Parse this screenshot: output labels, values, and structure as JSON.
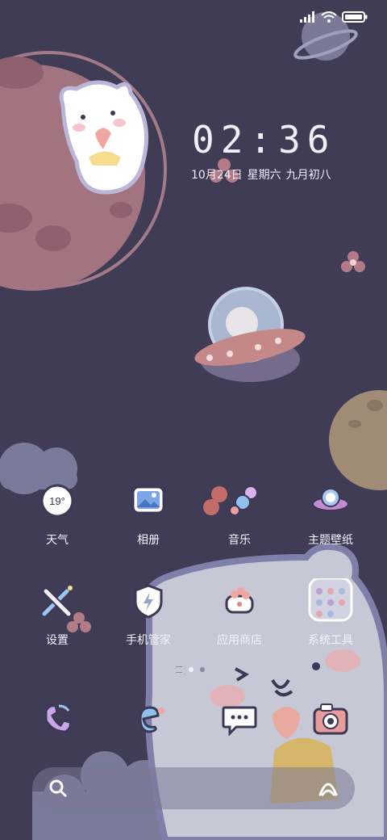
{
  "status_bar": {
    "signal_icon": "signal-bars-icon",
    "wifi_icon": "wifi-icon",
    "battery_icon": "battery-icon"
  },
  "clock": {
    "time": "02:36",
    "date": "10月24日",
    "weekday": "星期六",
    "lunar": "九月初八"
  },
  "weather_widget": {
    "temperature": "19°"
  },
  "apps": [
    {
      "label": "天气",
      "icon": "weather-icon"
    },
    {
      "label": "相册",
      "icon": "gallery-icon"
    },
    {
      "label": "音乐",
      "icon": "music-icon"
    },
    {
      "label": "主题壁纸",
      "icon": "theme-wallpaper-icon"
    },
    {
      "label": "设置",
      "icon": "settings-icon"
    },
    {
      "label": "手机管家",
      "icon": "phone-manager-icon"
    },
    {
      "label": "应用商店",
      "icon": "app-store-icon"
    },
    {
      "label": "系统工具",
      "icon": "system-tools-folder-icon"
    }
  ],
  "pager": {
    "page_count": 2,
    "active_page": 1
  },
  "dock": [
    {
      "icon": "phone-icon"
    },
    {
      "icon": "browser-icon"
    },
    {
      "icon": "messages-icon"
    },
    {
      "icon": "camera-icon"
    }
  ],
  "search_bar": {
    "search_icon": "search-icon",
    "assistant_icon": "assistant-icon"
  },
  "colors": {
    "background": "#413c56",
    "planet": "#a37480",
    "cloud": "#8a8aa8",
    "bear": "#c7c8d6",
    "text": "#f4f1f8"
  }
}
